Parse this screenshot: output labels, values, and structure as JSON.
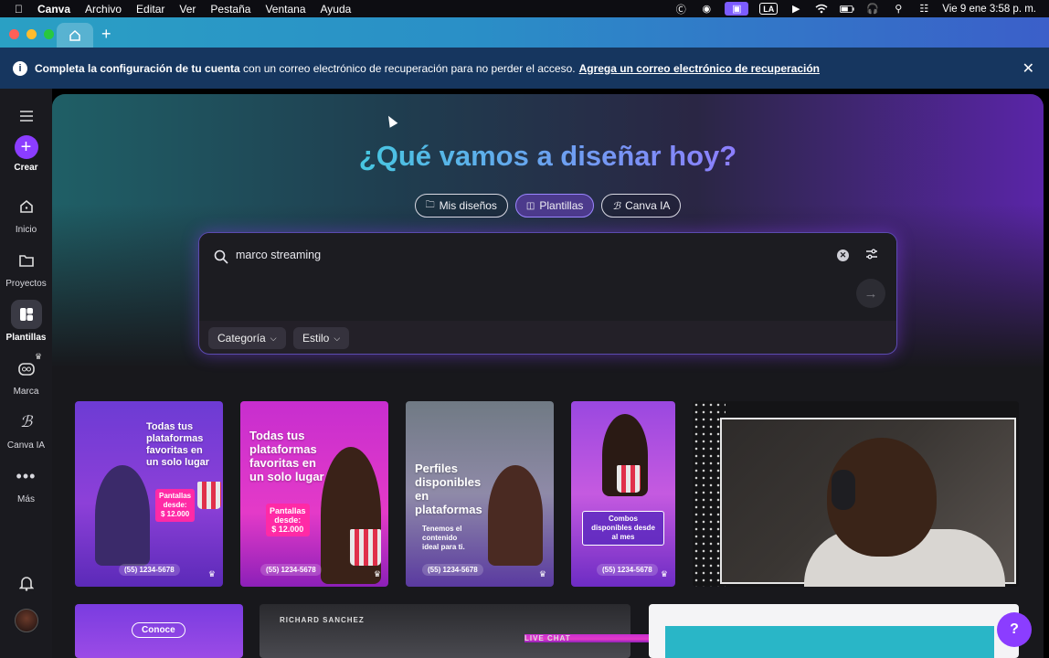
{
  "menubar": {
    "app": "Canva",
    "items": [
      "Archivo",
      "Editar",
      "Ver",
      "Pestaña",
      "Ventana",
      "Ayuda"
    ],
    "input_source": "LA",
    "clock": "Vie 9 ene  3:58 p. m."
  },
  "banner": {
    "bold_text": "Completa la configuración de tu cuenta",
    "text": " con un correo electrónico de recuperación para no perder el acceso.",
    "link": "Agrega un correo electrónico de recuperación"
  },
  "sidebar": {
    "create": "Crear",
    "items": [
      {
        "label": "Inicio",
        "icon": "home-icon"
      },
      {
        "label": "Proyectos",
        "icon": "folder-icon"
      },
      {
        "label": "Plantillas",
        "icon": "templates-icon"
      },
      {
        "label": "Marca",
        "icon": "brand-icon"
      },
      {
        "label": "Canva IA",
        "icon": "canva-ai-icon"
      },
      {
        "label": "Más",
        "icon": "more-icon"
      }
    ]
  },
  "hero": {
    "headline": "¿Qué vamos a diseñar hoy?",
    "pills": [
      "Mis diseños",
      "Plantillas",
      "Canva IA"
    ],
    "active_pill": "Plantillas"
  },
  "search": {
    "value": "marco streaming",
    "filters": [
      "Categoría",
      "Estilo"
    ]
  },
  "templates": [
    {
      "title": "Todas tus\nplataformas\nfavoritas en\nun solo lugar",
      "badge": "Pantallas\ndesde:\n$ 12.000",
      "phone": "(55) 1234-5678"
    },
    {
      "title": "Todas tus\nplataformas\nfavoritas en\nun solo lugar",
      "badge": "Pantallas\ndesde:\n$ 12.000",
      "phone": "(55) 1234-5678"
    },
    {
      "title": "Perfiles\ndisponibles\nen\nplataformas",
      "badge": "Tenemos el\ncontenido\nideal para ti.",
      "phone": "(55) 1234-5678"
    },
    {
      "title": "",
      "badge": "Combos\ndisponibles desde\nal mes",
      "phone": "(55) 1234-5678"
    }
  ],
  "row2": {
    "card_a": "Conoce",
    "card_b_top": "RICHARD SANCHEZ",
    "card_b_chat": "LIVE CHAT"
  },
  "colors": {
    "brand": "#8b3dff",
    "banner": "#16365f",
    "headline_start": "#45c9e0",
    "headline_end": "#8f7cff"
  }
}
